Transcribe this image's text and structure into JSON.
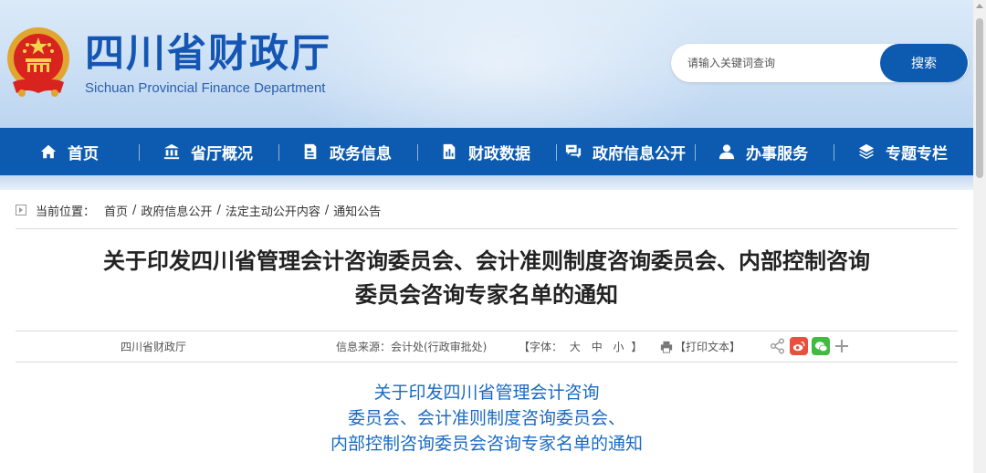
{
  "header": {
    "site_title": "四川省财政厅",
    "site_subtitle": "Sichuan Provincial Finance Department",
    "search_placeholder": "请输入关键词查询",
    "search_button": "搜索"
  },
  "nav": {
    "items": [
      {
        "label": "首页",
        "icon": "home-icon"
      },
      {
        "label": "省厅概况",
        "icon": "bank-icon"
      },
      {
        "label": "政务信息",
        "icon": "document-icon"
      },
      {
        "label": "财政数据",
        "icon": "data-icon"
      },
      {
        "label": "政府信息公开",
        "icon": "chat-icon"
      },
      {
        "label": "办事服务",
        "icon": "user-icon"
      },
      {
        "label": "专题专栏",
        "icon": "layers-icon"
      }
    ]
  },
  "breadcrumb": {
    "prefix": "当前位置：",
    "items": [
      "首页",
      "政府信息公开",
      "法定主动公开内容",
      "通知公告"
    ],
    "separator": "/"
  },
  "article": {
    "title_line1": "关于印发四川省管理会计咨询委员会、会计准则制度咨询委员会、内部控制咨询",
    "title_line2": "委员会咨询专家名单的通知",
    "publisher": "四川省财政厅",
    "source": "信息来源：会计处(行政审批处)",
    "font_label": "【字体：",
    "font_large": "大",
    "font_medium": "中",
    "font_small": "小",
    "font_close": "】",
    "print_label": "【打印文本】",
    "heading_line1": "关于印发四川省管理会计咨询",
    "heading_line2": "委员会、会计准则制度咨询委员会、",
    "heading_line3": "内部控制咨询委员会咨询专家名单的通知"
  },
  "colors": {
    "brand_blue": "#0d5bb0",
    "heading_blue": "#1a6ac2",
    "weibo_red": "#e94f3f",
    "wechat_green": "#3fbb3f"
  }
}
